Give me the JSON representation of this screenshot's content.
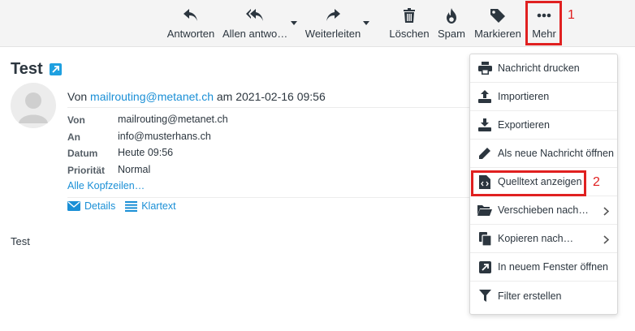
{
  "toolbar": {
    "buttons": [
      {
        "label": "Antworten",
        "icon": "reply-icon"
      },
      {
        "label": "Allen antwo…",
        "icon": "reply-all-icon"
      },
      {
        "label": "Weiterleiten",
        "icon": "forward-icon"
      },
      {
        "label": "Löschen",
        "icon": "trash-icon"
      },
      {
        "label": "Spam",
        "icon": "fire-icon"
      },
      {
        "label": "Markieren",
        "icon": "tag-icon"
      },
      {
        "label": "Mehr",
        "icon": "more-dots-icon"
      }
    ],
    "annotation_1": "1"
  },
  "message": {
    "subject": "Test",
    "from_prefix": "Von",
    "from_address": "mailrouting@metanet.ch",
    "date_prefix": "am",
    "date": "2021-02-16 09:56",
    "headers": [
      {
        "key": "Von",
        "value": "mailrouting@metanet.ch"
      },
      {
        "key": "An",
        "value": "info@musterhans.ch"
      },
      {
        "key": "Datum",
        "value": "Heute 09:56"
      },
      {
        "key": "Priorität",
        "value": "Normal"
      }
    ],
    "all_headers_link": "Alle Kopfzeilen…",
    "view_tabs": {
      "details": "Details",
      "plaintext": "Klartext"
    },
    "body": "Test"
  },
  "menu": {
    "items": [
      {
        "label": "Nachricht drucken",
        "icon": "print-icon"
      },
      {
        "label": "Importieren",
        "icon": "upload-icon"
      },
      {
        "label": "Exportieren",
        "icon": "download-icon"
      },
      {
        "label": "Als neue Nachricht öffnen",
        "icon": "pencil-icon"
      },
      {
        "label": "Quelltext anzeigen",
        "icon": "source-file-icon"
      },
      {
        "label": "Verschieben nach…",
        "icon": "folder-open-icon"
      },
      {
        "label": "Kopieren nach…",
        "icon": "copy-icon"
      },
      {
        "label": "In neuem Fenster öffnen",
        "icon": "external-window-icon"
      },
      {
        "label": "Filter erstellen",
        "icon": "filter-icon"
      }
    ],
    "annotation_2": "2"
  },
  "colors": {
    "accent": "#1a8fd6",
    "highlight_box": "#e02020",
    "toolbar_bg": "#f4f4f4"
  }
}
